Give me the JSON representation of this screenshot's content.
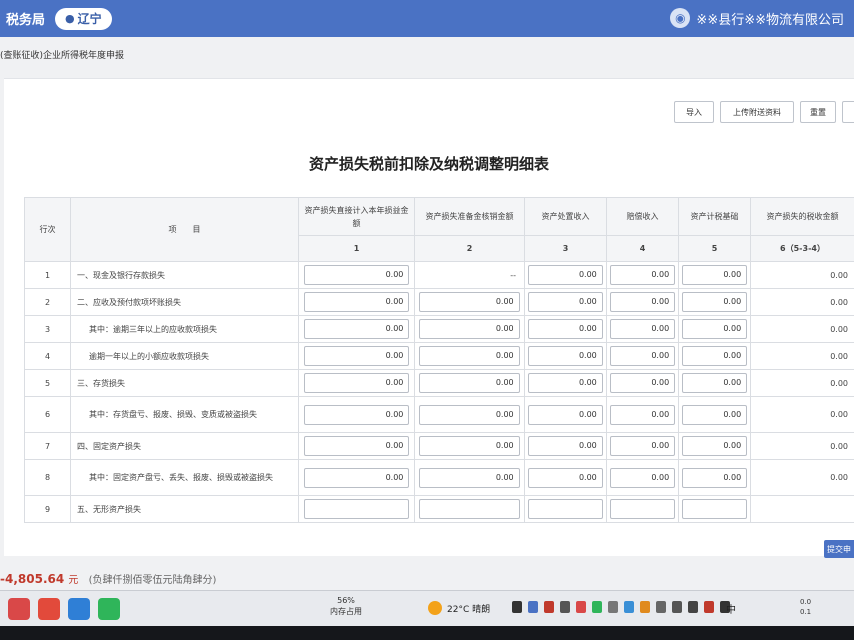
{
  "header": {
    "site_title": "税务局",
    "region": "辽宁",
    "user_name": "※※县行※※物流有限公司"
  },
  "breadcrumb": "(查账征收)企业所得税年度申报",
  "toolbar": {
    "import_label": "导入",
    "upload_label": "上传附送资料",
    "reset_label": "重置"
  },
  "form": {
    "title": "资产损失税前扣除及纳税调整明细表",
    "headers": {
      "row_no": "行次",
      "item": "项　　目",
      "col1": "资产损失直接计入本年损益金额",
      "col2": "资产损失准备金核销金额",
      "col3": "资产处置收入",
      "col4": "赔偿收入",
      "col5": "资产计税基础",
      "col6": "资产损失的税收金额"
    },
    "col_numbers": {
      "col1": "1",
      "col2": "2",
      "col3": "3",
      "col4": "4",
      "col5": "5",
      "col6": "6（5-3-4）"
    },
    "rows": [
      {
        "no": "1",
        "item": "一、现金及银行存款损失",
        "c1": "0.00",
        "c2": "--",
        "c3": "0.00",
        "c4": "0.00",
        "c5": "0.00",
        "c6": "0.00"
      },
      {
        "no": "2",
        "item": "二、应收及预付款项坏账损失",
        "c1": "0.00",
        "c2": "0.00",
        "c3": "0.00",
        "c4": "0.00",
        "c5": "0.00",
        "c6": "0.00"
      },
      {
        "no": "3",
        "item": "其中：逾期三年以上的应收款项损失",
        "c1": "0.00",
        "c2": "0.00",
        "c3": "0.00",
        "c4": "0.00",
        "c5": "0.00",
        "c6": "0.00"
      },
      {
        "no": "4",
        "item": "逾期一年以上的小额应收款项损失",
        "c1": "0.00",
        "c2": "0.00",
        "c3": "0.00",
        "c4": "0.00",
        "c5": "0.00",
        "c6": "0.00"
      },
      {
        "no": "5",
        "item": "三、存货损失",
        "c1": "0.00",
        "c2": "0.00",
        "c3": "0.00",
        "c4": "0.00",
        "c5": "0.00",
        "c6": "0.00"
      },
      {
        "no": "6",
        "item": "其中：存货盘亏、报废、损毁、变质或被盗损失",
        "c1": "0.00",
        "c2": "0.00",
        "c3": "0.00",
        "c4": "0.00",
        "c5": "0.00",
        "c6": "0.00"
      },
      {
        "no": "7",
        "item": "四、固定资产损失",
        "c1": "0.00",
        "c2": "0.00",
        "c3": "0.00",
        "c4": "0.00",
        "c5": "0.00",
        "c6": "0.00"
      },
      {
        "no": "8",
        "item": "其中：固定资产盘亏、丢失、报废、损毁或被盗损失",
        "c1": "0.00",
        "c2": "0.00",
        "c3": "0.00",
        "c4": "0.00",
        "c5": "0.00",
        "c6": "0.00"
      },
      {
        "no": "9",
        "item": "五、无形资产损失",
        "c1": "",
        "c2": "",
        "c3": "",
        "c4": "",
        "c5": "",
        "c6": ""
      }
    ]
  },
  "submit_label": "提交申",
  "footer_total": {
    "amount": "-4,805.64",
    "unit": "元",
    "upper": "(负肆仟捌佰零伍元陆角肆分)"
  },
  "taskbar": {
    "memory_percent": "56%",
    "memory_label": "内存占用",
    "weather": "22°C 晴朗",
    "ime": "中",
    "net_up": "0.0",
    "net_down": "0.1"
  },
  "colors": {
    "header_blue": "#4a72c4",
    "total_red": "#c0392b"
  }
}
